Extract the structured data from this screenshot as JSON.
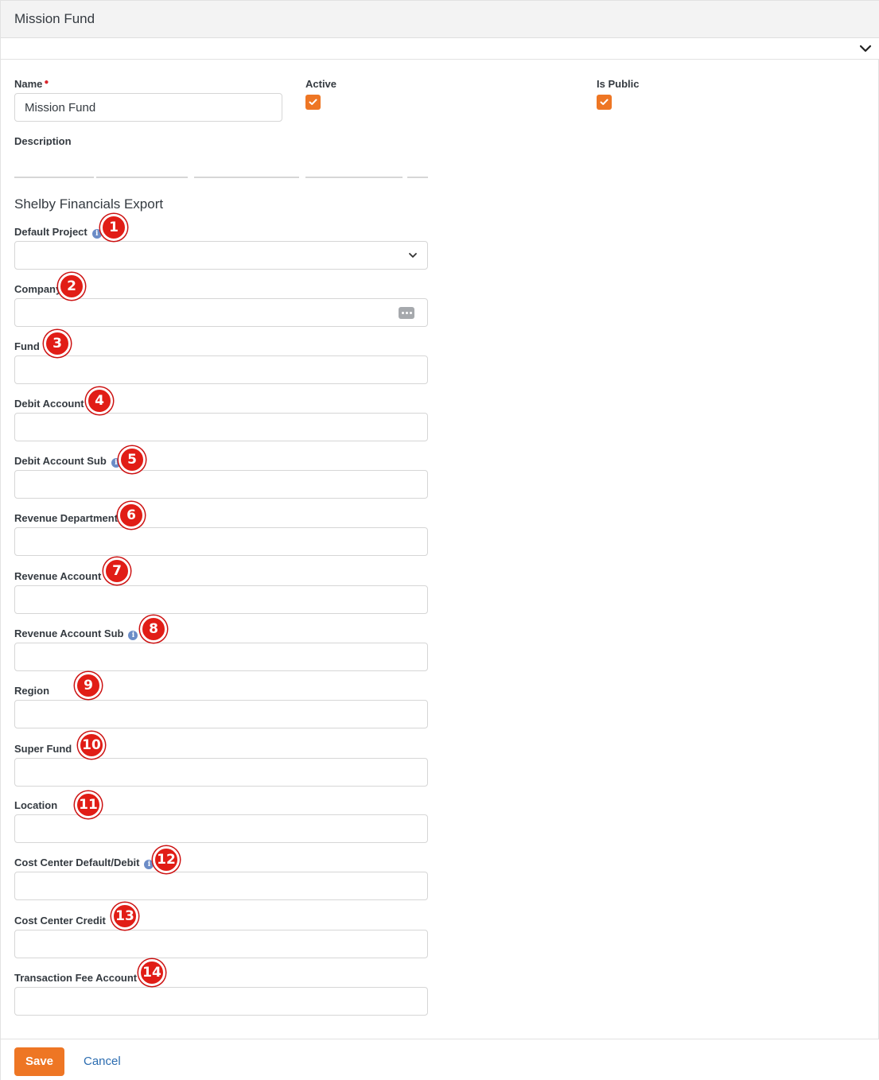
{
  "header": {
    "title": "Mission Fund"
  },
  "form": {
    "name_label": "Name",
    "name_value": "Mission Fund",
    "active_label": "Active",
    "active_checked": true,
    "public_label": "Is Public",
    "public_checked": true,
    "description_label": "Description"
  },
  "section": {
    "title": "Shelby Financials Export"
  },
  "fields": [
    {
      "label": "Default Project",
      "info": true,
      "badge": "1",
      "type": "dropdown"
    },
    {
      "label": "Company",
      "info": false,
      "badge": "2",
      "type": "picker"
    },
    {
      "label": "Fund",
      "info": false,
      "badge": "3",
      "type": "text"
    },
    {
      "label": "Debit Account",
      "info": false,
      "badge": "4",
      "type": "text"
    },
    {
      "label": "Debit Account Sub",
      "info": true,
      "badge": "5",
      "type": "text"
    },
    {
      "label": "Revenue Department",
      "info": false,
      "badge": "6",
      "type": "text"
    },
    {
      "label": "Revenue Account",
      "info": false,
      "badge": "7",
      "type": "text"
    },
    {
      "label": "Revenue Account Sub",
      "info": true,
      "badge": "8",
      "type": "text"
    },
    {
      "label": "Region",
      "info": false,
      "badge": "9",
      "type": "text"
    },
    {
      "label": "Super Fund",
      "info": false,
      "badge": "10",
      "type": "text"
    },
    {
      "label": "Location",
      "info": false,
      "badge": "11",
      "type": "text"
    },
    {
      "label": "Cost Center Default/Debit",
      "info": true,
      "badge": "12",
      "type": "text"
    },
    {
      "label": "Cost Center Credit",
      "info": false,
      "badge": "13",
      "type": "text"
    },
    {
      "label": "Transaction Fee Account",
      "info": true,
      "badge": "14",
      "type": "text"
    }
  ],
  "footer": {
    "save_label": "Save",
    "cancel_label": "Cancel"
  },
  "colors": {
    "accent": "#ee7624",
    "badge": "#e11d16",
    "link": "#2b6cb0",
    "info": "#6b8cc7"
  }
}
